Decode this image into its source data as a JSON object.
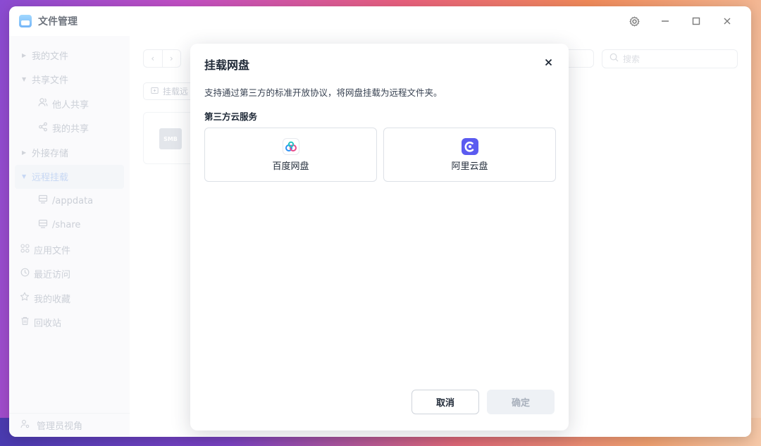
{
  "app": {
    "title": "文件管理"
  },
  "sidebar": {
    "items": [
      {
        "label": "我的文件"
      },
      {
        "label": "共享文件"
      },
      {
        "label": "他人共享"
      },
      {
        "label": "我的共享"
      },
      {
        "label": "外接存储"
      },
      {
        "label": "远程挂载"
      },
      {
        "label": "/appdata"
      },
      {
        "label": "/share"
      },
      {
        "label": "应用文件"
      },
      {
        "label": "最近访问"
      },
      {
        "label": "我的收藏"
      },
      {
        "label": "回收站"
      }
    ],
    "admin_view": "管理员视角"
  },
  "main": {
    "search_placeholder": "搜索",
    "mount_button": "挂载远",
    "file_card_badge": "SMB"
  },
  "dialog": {
    "title": "挂载网盘",
    "description": "支持通过第三方的标准开放协议，将网盘挂载为远程文件夹。",
    "section_title": "第三方云服务",
    "services": [
      {
        "label": "百度网盘"
      },
      {
        "label": "阿里云盘"
      }
    ],
    "cancel_label": "取消",
    "ok_label": "确定"
  },
  "colors": {
    "accent": "#2b8ff3",
    "aliyun_brand": "#5b5bf0"
  }
}
